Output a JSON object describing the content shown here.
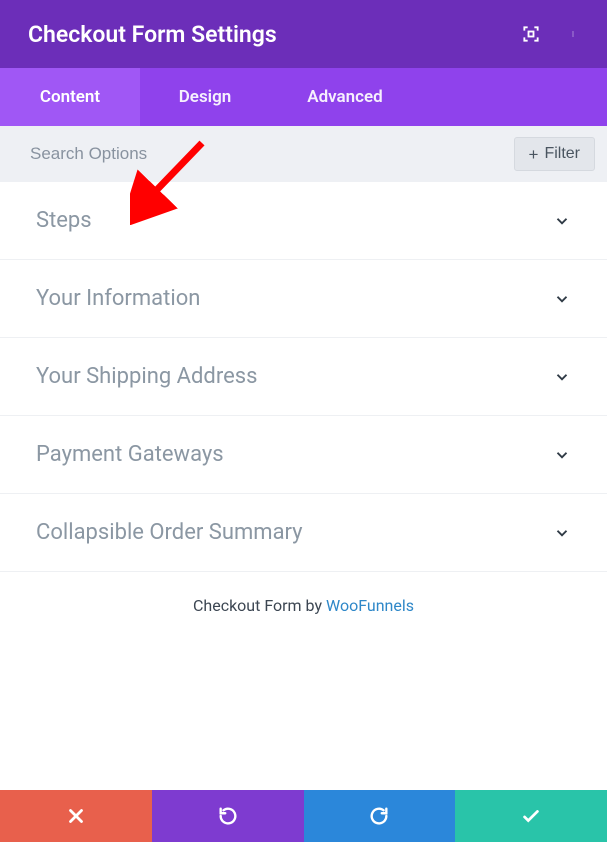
{
  "header": {
    "title": "Checkout Form Settings"
  },
  "tabs": [
    {
      "label": "Content",
      "active": true
    },
    {
      "label": "Design",
      "active": false
    },
    {
      "label": "Advanced",
      "active": false
    }
  ],
  "search": {
    "placeholder": "Search Options"
  },
  "filter": {
    "label": "Filter"
  },
  "sections": [
    {
      "title": "Steps"
    },
    {
      "title": "Your Information"
    },
    {
      "title": "Your Shipping Address"
    },
    {
      "title": "Payment Gateways"
    },
    {
      "title": "Collapsible Order Summary"
    }
  ],
  "attribution": {
    "prefix": "Checkout Form by ",
    "link": "WooFunnels"
  },
  "colors": {
    "header": "#6c2eb9",
    "tabs": "#8f42ec",
    "tab_active": "#a057f5",
    "cancel": "#e8604c",
    "undo": "#7e3bd0",
    "redo": "#2b87da",
    "save": "#29c4a9",
    "link": "#2e87c8"
  }
}
